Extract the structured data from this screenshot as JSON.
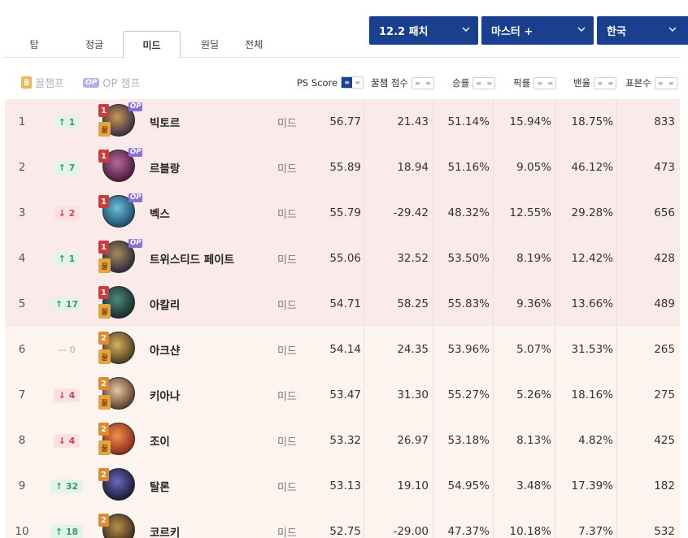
{
  "tabs": [
    "탑",
    "정글",
    "미드",
    "원딜",
    "전체"
  ],
  "active_tab": 2,
  "filters": {
    "patch": "12.2 패치",
    "tier": "마스터 +",
    "region": "한국"
  },
  "legend": {
    "kkul_icon": "꿀",
    "kkul_label": "꿀챔프",
    "op_icon": "OP",
    "op_label": "OP 챔프"
  },
  "columns": {
    "ps_score": "PS Score",
    "kkul_score": "꿀챔 점수",
    "win_rate": "승률",
    "pick_rate": "픽률",
    "ban_rate": "밴율",
    "sample": "표본수"
  },
  "colors": {
    "accent": "#1a3f8f",
    "tier1": "#d23a3a",
    "tier2": "#e08a2a",
    "up": "#3a9a6a",
    "down": "#d04545"
  },
  "rows": [
    {
      "rank": "1",
      "dir": "up",
      "change": "↑ 1",
      "tier": "1",
      "kkul": true,
      "op": true,
      "name": "빅토르",
      "lane": "미드",
      "ps": "56.77",
      "kk": "21.43",
      "wr": "51.14%",
      "pr": "15.94%",
      "br": "18.75%",
      "ss": "833",
      "c1": "#3a2a4a",
      "c2": "#c89a50"
    },
    {
      "rank": "2",
      "dir": "up",
      "change": "↑ 7",
      "tier": "1",
      "kkul": false,
      "op": true,
      "name": "르블랑",
      "lane": "미드",
      "ps": "55.89",
      "kk": "18.94",
      "wr": "51.16%",
      "pr": "9.05%",
      "br": "46.12%",
      "ss": "473",
      "c1": "#4a1a3a",
      "c2": "#b86a9a"
    },
    {
      "rank": "3",
      "dir": "down",
      "change": "↓ 2",
      "tier": "1",
      "kkul": false,
      "op": true,
      "name": "벡스",
      "lane": "미드",
      "ps": "55.79",
      "kk": "-29.42",
      "wr": "48.32%",
      "pr": "12.55%",
      "br": "29.28%",
      "ss": "656",
      "c1": "#1a4a6a",
      "c2": "#6ac0d8"
    },
    {
      "rank": "4",
      "dir": "up",
      "change": "↑ 1",
      "tier": "1",
      "kkul": true,
      "op": true,
      "name": "트위스티드 페이트",
      "lane": "미드",
      "ps": "55.06",
      "kk": "32.52",
      "wr": "53.50%",
      "pr": "8.19%",
      "br": "12.42%",
      "ss": "428",
      "c1": "#2a2a3a",
      "c2": "#a88a5a"
    },
    {
      "rank": "5",
      "dir": "up",
      "change": "↑ 17",
      "tier": "1",
      "kkul": true,
      "op": false,
      "name": "아칼리",
      "lane": "미드",
      "ps": "54.71",
      "kk": "58.25",
      "wr": "55.83%",
      "pr": "9.36%",
      "br": "13.66%",
      "ss": "489",
      "c1": "#1a2a2a",
      "c2": "#4a8a7a"
    },
    {
      "rank": "6",
      "dir": "same",
      "change": "— 0",
      "tier": "2",
      "kkul": true,
      "op": false,
      "name": "아크샨",
      "lane": "미드",
      "ps": "54.14",
      "kk": "24.35",
      "wr": "53.96%",
      "pr": "5.07%",
      "br": "31.53%",
      "ss": "265",
      "c1": "#4a3a1a",
      "c2": "#d8b060"
    },
    {
      "rank": "7",
      "dir": "down",
      "change": "↓ 4",
      "tier": "2",
      "kkul": true,
      "op": false,
      "name": "키아나",
      "lane": "미드",
      "ps": "53.47",
      "kk": "31.30",
      "wr": "55.27%",
      "pr": "5.26%",
      "br": "18.16%",
      "ss": "275",
      "c1": "#5a3a2a",
      "c2": "#e8c8a0"
    },
    {
      "rank": "8",
      "dir": "down",
      "change": "↓ 4",
      "tier": "2",
      "kkul": true,
      "op": false,
      "name": "조이",
      "lane": "미드",
      "ps": "53.32",
      "kk": "26.97",
      "wr": "53.18%",
      "pr": "8.13%",
      "br": "4.82%",
      "ss": "425",
      "c1": "#8a2a1a",
      "c2": "#f0904a"
    },
    {
      "rank": "9",
      "dir": "up",
      "change": "↑ 32",
      "tier": "2",
      "kkul": false,
      "op": false,
      "name": "탈론",
      "lane": "미드",
      "ps": "53.13",
      "kk": "19.10",
      "wr": "54.95%",
      "pr": "3.48%",
      "br": "17.39%",
      "ss": "182",
      "c1": "#1a1a3a",
      "c2": "#6a6ab8"
    },
    {
      "rank": "10",
      "dir": "up",
      "change": "↑ 18",
      "tier": "2",
      "kkul": false,
      "op": false,
      "name": "코르키",
      "lane": "미드",
      "ps": "52.75",
      "kk": "-29.00",
      "wr": "47.37%",
      "pr": "10.18%",
      "br": "7.37%",
      "ss": "532",
      "c1": "#3a2a1a",
      "c2": "#b8904a"
    }
  ]
}
